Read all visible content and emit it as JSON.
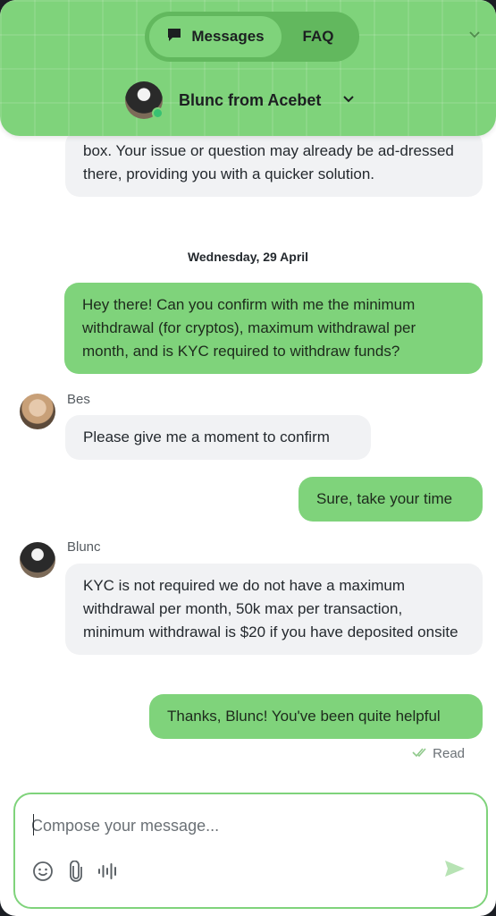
{
  "header": {
    "tabs": [
      {
        "label": "Messages",
        "icon": "chat-bubble-icon",
        "active": true
      },
      {
        "label": "FAQ",
        "active": false
      }
    ],
    "agent_title": "Blunc from Acebet",
    "online": true
  },
  "messages": [
    {
      "direction": "in",
      "text": "box. Your issue or question may already be ad-dressed there, providing you with a quicker solution."
    },
    {
      "type": "date",
      "text": "Wednesday, 29 April"
    },
    {
      "direction": "out",
      "text": "Hey there! Can you confirm with me the minimum withdrawal (for cryptos), maximum withdrawal per month, and is KYC required to withdraw funds?"
    },
    {
      "direction": "in",
      "sender": "Bes",
      "text": "Please give me a moment to confirm"
    },
    {
      "direction": "out",
      "text": "Sure, take your time"
    },
    {
      "direction": "in",
      "sender": "Blunc",
      "text": "KYC is not required we do not have a maximum withdrawal per month, 50k max per transaction, minimum withdrawal is $20 if you have deposited onsite"
    },
    {
      "direction": "out",
      "text": "Thanks, Blunc! You've been quite helpful"
    }
  ],
  "read_status": "Read",
  "composer": {
    "placeholder": "Compose your message...",
    "tools": [
      "emoji-icon",
      "paperclip-icon",
      "voice-waveform-icon"
    ],
    "send_icon": "send-icon"
  },
  "colors": {
    "accent": "#7fd37b",
    "accent_dark": "#62b85e",
    "incoming_bg": "#f1f2f4"
  }
}
